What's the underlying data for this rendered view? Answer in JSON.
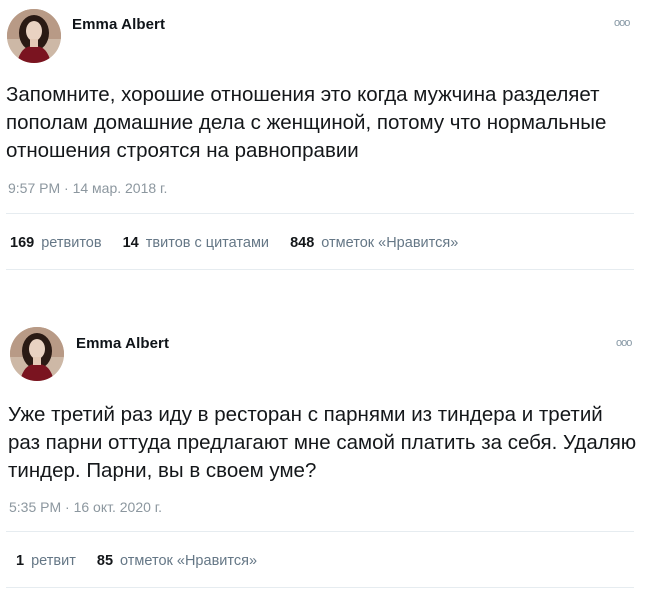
{
  "tweets": [
    {
      "author": "Emma Albert",
      "text": "Запомните, хорошие отношения это когда мужчина разделяет пополам домашние дела с женщиной, потому что нормальные отношения строятся на равноправии",
      "timestamp": "9:57 PM · 14 мар. 2018 г.",
      "stats": [
        {
          "count": "169",
          "label": "ретвитов"
        },
        {
          "count": "14",
          "label": "твитов с цитатами"
        },
        {
          "count": "848",
          "label": "отметок «Нравится»"
        }
      ]
    },
    {
      "author": "Emma Albert",
      "text": "Уже третий раз иду в ресторан с парнями из тиндера и третий раз парни оттуда предлагают мне самой платить за себя. Удаляю тиндер. Парни, вы в своем уме?",
      "timestamp": "5:35 PM · 16 окт. 2020 г.",
      "stats": [
        {
          "count": "1",
          "label": "ретвит"
        },
        {
          "count": "85",
          "label": "отметок «Нравится»"
        }
      ]
    }
  ],
  "icons": {
    "more": "more-dots-icon",
    "avatar": "avatar"
  },
  "colors": {
    "text": "#14171a",
    "muted": "#657786",
    "divider": "#e6ecf0"
  }
}
